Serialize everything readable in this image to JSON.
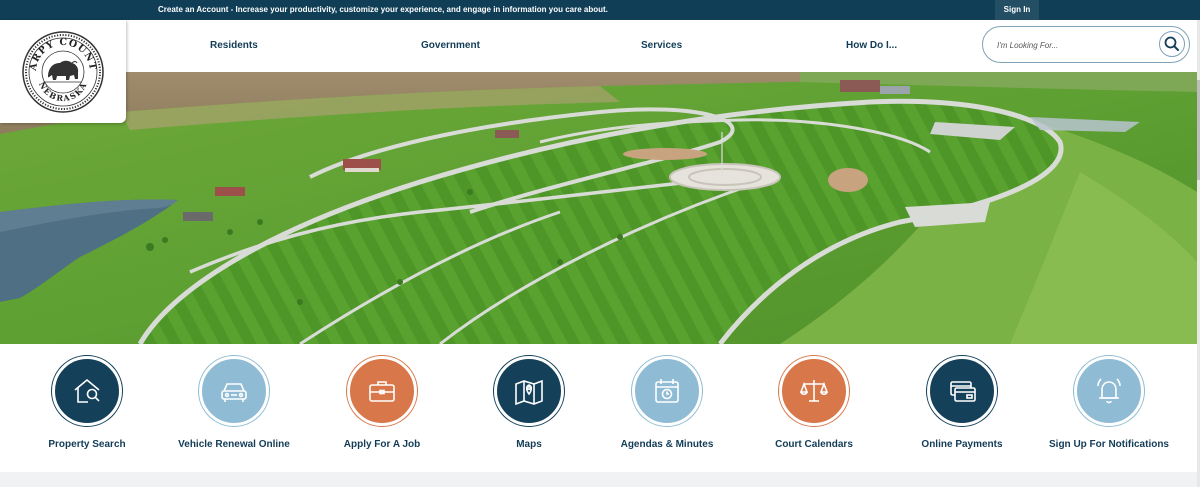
{
  "topbar": {
    "message": "Create an Account - Increase your productivity, customize your experience, and engage in information you care about.",
    "signin_label": "Sign In"
  },
  "logo": {
    "text_top": "SARPY COUNTY",
    "text_bottom": "NEBRASKA"
  },
  "nav": {
    "items": [
      {
        "label": "Residents"
      },
      {
        "label": "Government"
      },
      {
        "label": "Services"
      },
      {
        "label": "How Do I..."
      }
    ]
  },
  "search": {
    "placeholder": "I'm Looking For...",
    "icon": "search-icon"
  },
  "hero": {
    "alt": "Aerial view of Sarpy County park"
  },
  "quick_links": [
    {
      "label": "Property Search",
      "icon": "house-search-icon",
      "color": "#14405a"
    },
    {
      "label": "Vehicle Renewal Online",
      "icon": "car-icon",
      "color": "#8fbcd4"
    },
    {
      "label": "Apply For A Job",
      "icon": "briefcase-icon",
      "color": "#d8774a"
    },
    {
      "label": "Maps",
      "icon": "map-pin-icon",
      "color": "#14405a"
    },
    {
      "label": "Agendas & Minutes",
      "icon": "calendar-icon",
      "color": "#8fbcd4"
    },
    {
      "label": "Court Calendars",
      "icon": "scales-icon",
      "color": "#d8774a"
    },
    {
      "label": "Online Payments",
      "icon": "credit-card-icon",
      "color": "#14405a"
    },
    {
      "label": "Sign Up For Notifications",
      "icon": "bell-icon",
      "color": "#8fbcd4"
    }
  ]
}
